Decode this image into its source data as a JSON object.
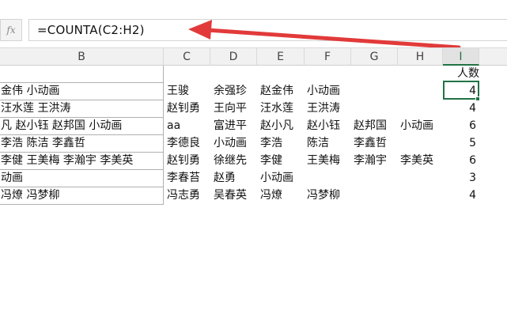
{
  "formula_bar": {
    "fx_label": "fx",
    "formula": "=COUNTA(C2:H2)"
  },
  "columns": [
    "B",
    "C",
    "D",
    "E",
    "F",
    "G",
    "H",
    "I"
  ],
  "active_column": "I",
  "header_row": {
    "count_label": "人数"
  },
  "rows": [
    {
      "b": "金伟 小动画",
      "names": [
        "王骏",
        "余强珍",
        "赵金伟",
        "小动画",
        "",
        ""
      ],
      "count": "4"
    },
    {
      "b": "汪水莲 王洪涛",
      "names": [
        "赵钊勇",
        "王向平",
        "汪水莲",
        "王洪涛",
        "",
        ""
      ],
      "count": "4"
    },
    {
      "b": "凡 赵小钰 赵邦国 小动画",
      "names": [
        "aa",
        "富进平",
        "赵小凡",
        "赵小钰",
        "赵邦国",
        "小动画"
      ],
      "count": "6"
    },
    {
      "b": "李浩 陈洁 李鑫哲",
      "names": [
        "李德良",
        "小动画",
        "李浩",
        "陈洁",
        "李鑫哲",
        ""
      ],
      "count": "5"
    },
    {
      "b": "李健 王美梅 李瀚宇 李美英",
      "names": [
        "赵钊勇",
        "徐继先",
        "李健",
        "王美梅",
        "李瀚宇",
        "李美英"
      ],
      "count": "6"
    },
    {
      "b": "动画",
      "names": [
        "李春苔",
        "赵勇",
        "小动画",
        "",
        "",
        ""
      ],
      "count": "3"
    },
    {
      "b": "冯燎 冯梦柳",
      "names": [
        "冯志勇",
        "吴春英",
        "冯燎",
        "冯梦柳",
        "",
        ""
      ],
      "count": "4"
    }
  ],
  "colors": {
    "accent": "#217346",
    "arrow": "#e23a3a"
  }
}
